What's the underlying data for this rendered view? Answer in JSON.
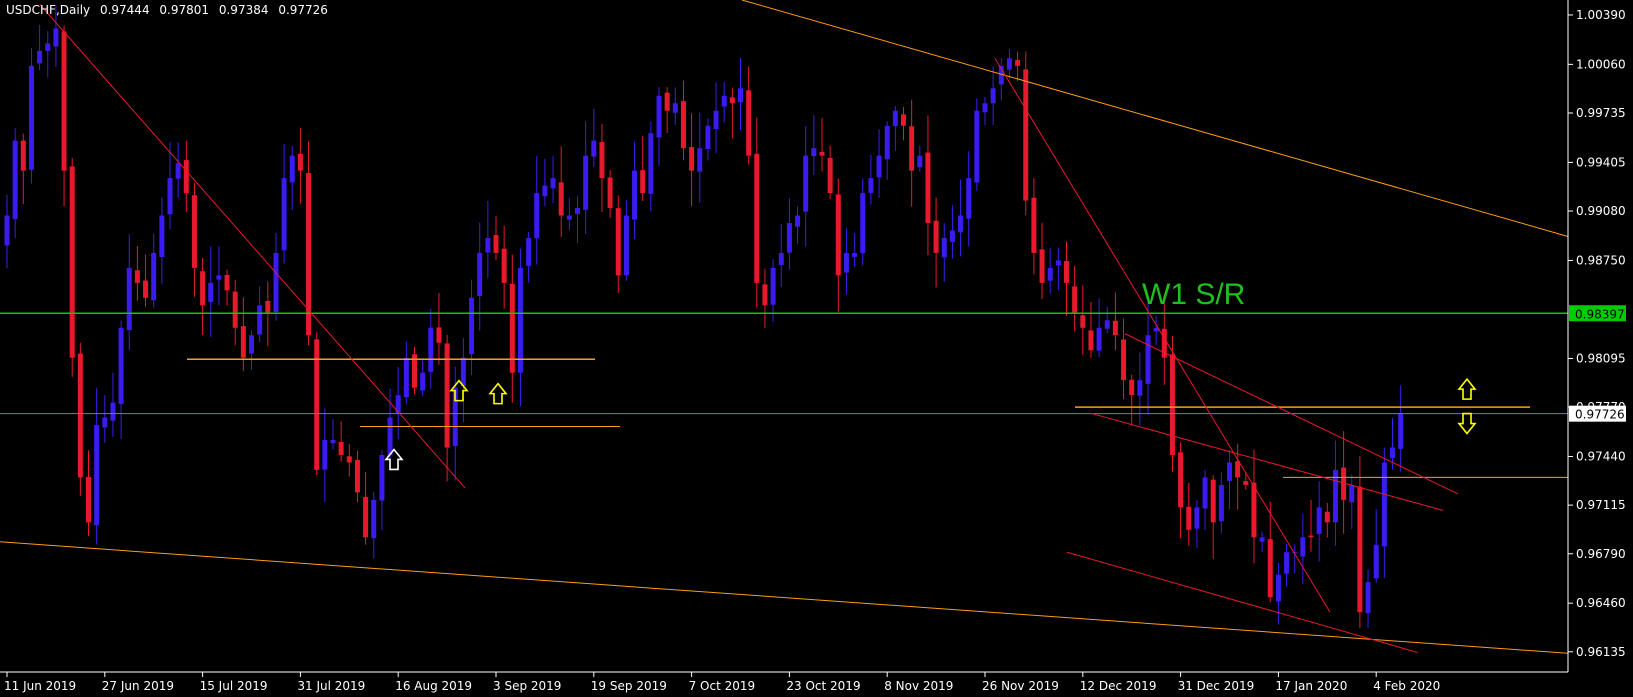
{
  "header": {
    "symbol": "USDCHF,Daily",
    "open": "0.97444",
    "high": "0.97801",
    "low": "0.97384",
    "close": "0.97726"
  },
  "annotation": "W1 S/R",
  "colors": {
    "background": "#000000",
    "bull": "#3b1cf0",
    "bear": "#e8192c",
    "axis": "#ffffff",
    "sr": "#00cc00",
    "orange": "#ff9b1a",
    "trend": "#e8192c",
    "price_line": "#6a7db0",
    "arrow_yellow": "#ffff00",
    "arrow_white": "#ffffff"
  },
  "chart_data": {
    "type": "candlestick",
    "ylim": [
      0.96,
      1.0049
    ],
    "yticks": [
      "1.00390",
      "1.00060",
      "0.99735",
      "0.99405",
      "0.99080",
      "0.98750",
      "0.98095",
      "0.97770",
      "0.97440",
      "0.97115",
      "0.96790",
      "0.96460",
      "0.96135"
    ],
    "xticks": [
      "11 Jun 2019",
      "27 Jun 2019",
      "15 Jul 2019",
      "31 Jul 2019",
      "16 Aug 2019",
      "3 Sep 2019",
      "19 Sep 2019",
      "7 Oct 2019",
      "23 Oct 2019",
      "8 Nov 2019",
      "26 Nov 2019",
      "12 Dec 2019",
      "31 Dec 2019",
      "17 Jan 2020",
      "4 Feb 2020"
    ],
    "xtick_bar_index": [
      0,
      12,
      24,
      36,
      48,
      60,
      72,
      84,
      96,
      108,
      120,
      132,
      144,
      156,
      168
    ],
    "current_price": "0.97726",
    "sr_level": "0.98397",
    "closes": [
      0.9905,
      0.9955,
      0.9935,
      1.0005,
      1.0015,
      1.002,
      1.003,
      0.9935,
      0.981,
      0.973,
      0.97,
      0.9765,
      0.977,
      0.978,
      0.983,
      0.987,
      0.986,
      0.985,
      0.988,
      0.9905,
      0.993,
      0.994,
      0.992,
      0.987,
      0.9845,
      0.986,
      0.9865,
      0.9855,
      0.983,
      0.981,
      0.9825,
      0.9845,
      0.984,
      0.988,
      0.993,
      0.9945,
      0.9935,
      0.9825,
      0.9735,
      0.9755,
      0.9755,
      0.9745,
      0.974,
      0.972,
      0.969,
      0.9715,
      0.9745,
      0.977,
      0.9785,
      0.981,
      0.979,
      0.98,
      0.983,
      0.982,
      0.975,
      0.979,
      0.981,
      0.985,
      0.988,
      0.989,
      0.988,
      0.986,
      0.98,
      0.987,
      0.989,
      0.992,
      0.9925,
      0.993,
      0.9905,
      0.9905,
      0.991,
      0.9945,
      0.9955,
      0.993,
      0.991,
      0.9865,
      0.9905,
      0.9935,
      0.992,
      0.996,
      0.9985,
      0.9975,
      0.998,
      0.995,
      0.9935,
      0.995,
      0.9965,
      0.9975,
      0.9985,
      0.998,
      0.999,
      0.9945,
      0.986,
      0.9845,
      0.987,
      0.988,
      0.99,
      0.9905,
      0.9945,
      0.995,
      0.9945,
      0.992,
      0.9865,
      0.988,
      0.988,
      0.992,
      0.993,
      0.9945,
      0.9965,
      0.9975,
      0.9965,
      0.9935,
      0.9945,
      0.99,
      0.988,
      0.989,
      0.9895,
      0.9905,
      0.993,
      0.9975,
      0.998,
      0.999,
      1.0005,
      1.001,
      1.0005,
      0.9915,
      0.988,
      0.986,
      0.987,
      0.9875,
      0.986,
      0.984,
      0.983,
      0.9815,
      0.983,
      0.9835,
      0.9825,
      0.9795,
      0.9785,
      0.9795,
      0.9825,
      0.983,
      0.981,
      0.9745,
      0.971,
      0.9695,
      0.971,
      0.973,
      0.97,
      0.9725,
      0.974,
      0.973,
      0.9725,
      0.969,
      0.969,
      0.965,
      0.9665,
      0.968,
      0.968,
      0.969,
      0.969,
      0.971,
      0.97,
      0.9735,
      0.9715,
      0.9725,
      0.964,
      0.966,
      0.9685,
      0.974,
      0.975,
      0.9773
    ]
  }
}
